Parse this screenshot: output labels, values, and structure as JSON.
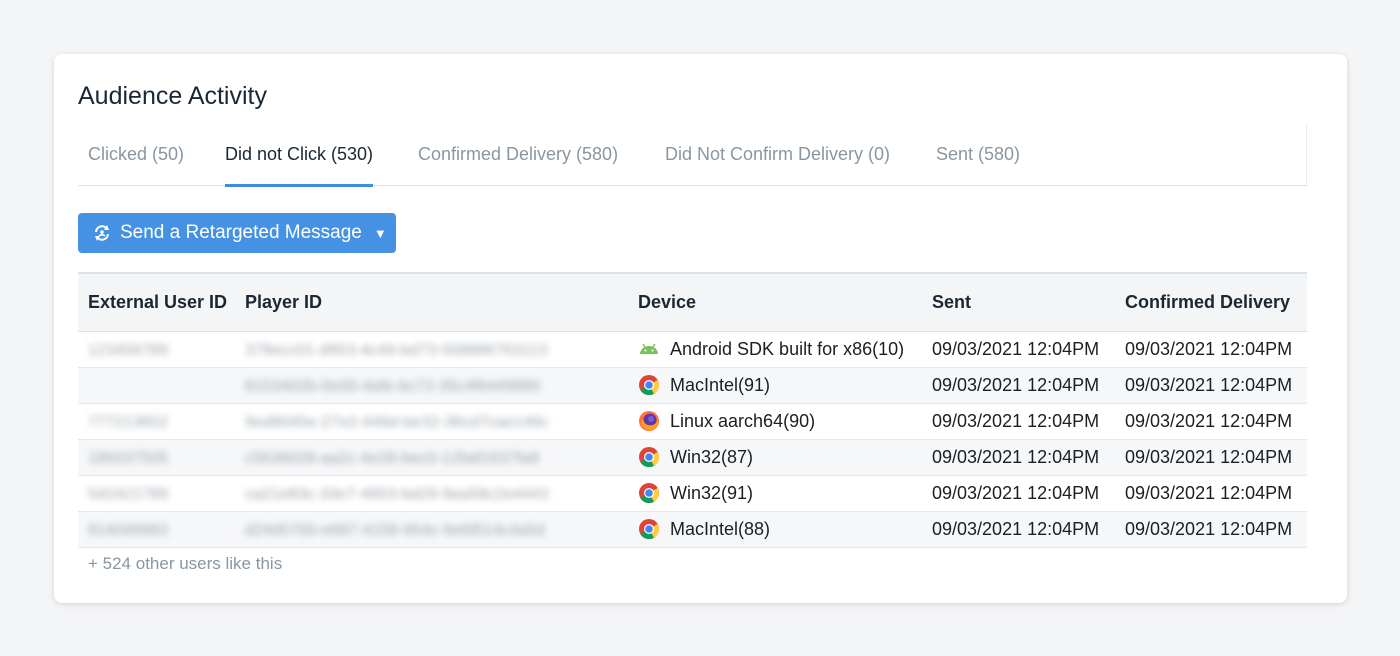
{
  "card": {
    "title": "Audience Activity"
  },
  "tabs": [
    {
      "label": "Clicked (50)",
      "active": false
    },
    {
      "label": "Did not Click (530)",
      "active": true
    },
    {
      "label": "Confirmed Delivery (580)",
      "active": false
    },
    {
      "label": "Did Not Confirm Delivery (0)",
      "active": false
    },
    {
      "label": "Sent (580)",
      "active": false
    }
  ],
  "retarget_button": {
    "label": "Send a Retargeted Message",
    "icon": "retarget-icon",
    "caret": "▼"
  },
  "table": {
    "headers": {
      "external_user_id": "External User ID",
      "player_id": "Player ID",
      "device": "Device",
      "sent": "Sent",
      "confirmed_delivery": "Confirmed Delivery"
    },
    "rows": [
      {
        "external_user_id": "123456789",
        "player_id": "378ecc01-d953-4c49-bd73-508886763113",
        "device_icon": "android-icon",
        "device": "Android SDK built for x86(10)",
        "sent": "09/03/2021 12:04PM",
        "confirmed_delivery": "09/03/2021 12:04PM"
      },
      {
        "external_user_id": "",
        "player_id": "8153402b-0e00-4afe-bc72-35c4f6449880",
        "device_icon": "chrome-icon",
        "device": "MacIntel(91)",
        "sent": "09/03/2021 12:04PM",
        "confirmed_delivery": "09/03/2021 12:04PM"
      },
      {
        "external_user_id": "777213652",
        "player_id": "9ed8045e-27e2-449d-be32-38cd7cae149c",
        "device_icon": "firefox-icon",
        "device": "Linux aarch64(90)",
        "sent": "09/03/2021 12:04PM",
        "confirmed_delivery": "09/03/2021 12:04PM"
      },
      {
        "external_user_id": "185037505",
        "player_id": "c5636028-aa2c-4e28-bec0-12fa81637fa8",
        "device_icon": "chrome-icon",
        "device": "Win32(87)",
        "sent": "09/03/2021 12:04PM",
        "confirmed_delivery": "09/03/2021 12:04PM"
      },
      {
        "external_user_id": "542421789",
        "player_id": "ca21e83c-33e7-4953-bd29-9ea58c2e4443",
        "device_icon": "chrome-icon",
        "device": "Win32(91)",
        "sent": "09/03/2021 12:04PM",
        "confirmed_delivery": "09/03/2021 12:04PM"
      },
      {
        "external_user_id": "814049983",
        "player_id": "d24d5700-e687-4158-954c-9efd514c4a5d",
        "device_icon": "chrome-icon",
        "device": "MacIntel(88)",
        "sent": "09/03/2021 12:04PM",
        "confirmed_delivery": "09/03/2021 12:04PM"
      }
    ]
  },
  "footer": {
    "text": "+ 524 other users like this"
  },
  "colors": {
    "accent": "#4592e4",
    "muted_text": "#8a96a0",
    "header_bg": "#f4f5f7"
  }
}
